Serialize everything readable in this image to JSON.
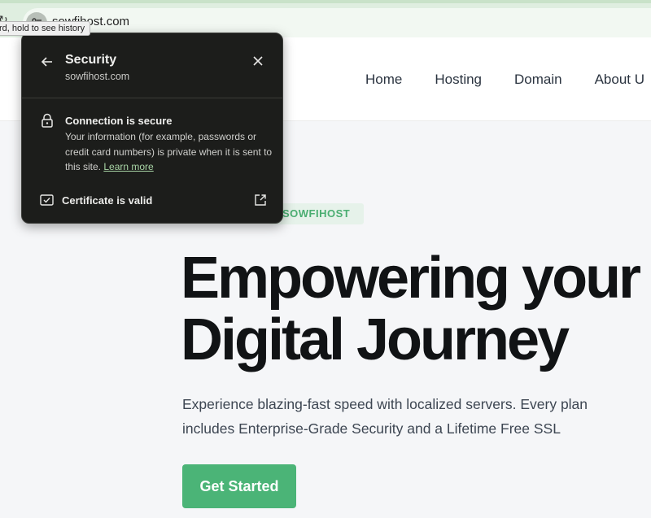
{
  "browser": {
    "url": "sowfihost.com",
    "tooltip": "rd, hold to see history"
  },
  "nav": {
    "items": [
      "Home",
      "Hosting",
      "Domain",
      "About U"
    ]
  },
  "hero": {
    "badge": "SOWFIHOST",
    "title_line1": "Empowering your",
    "title_line2": "Digital Journey",
    "subtitle_line1": "Experience blazing-fast speed with localized servers. Every plan",
    "subtitle_line2": "includes Enterprise-Grade Security and a Lifetime Free SSL",
    "cta": "Get Started"
  },
  "popup": {
    "title": "Security",
    "domain": "sowfihost.com",
    "connection_title": "Connection is secure",
    "connection_desc": "Your information (for example, passwords or credit card numbers) is private when it is sent to this site.",
    "learn_more": "Learn more",
    "certificate": "Certificate is valid"
  },
  "icons": {
    "back": "arrow-left-icon",
    "close": "close-icon",
    "lock": "lock-icon",
    "certificate": "certificate-icon",
    "open_external": "external-link-icon",
    "site_info": "tune-icon"
  },
  "colors": {
    "accent": "#4bb477",
    "badge_text": "#4bae72",
    "popup_bg": "#1c1d1b",
    "link": "#a9d6a6"
  }
}
